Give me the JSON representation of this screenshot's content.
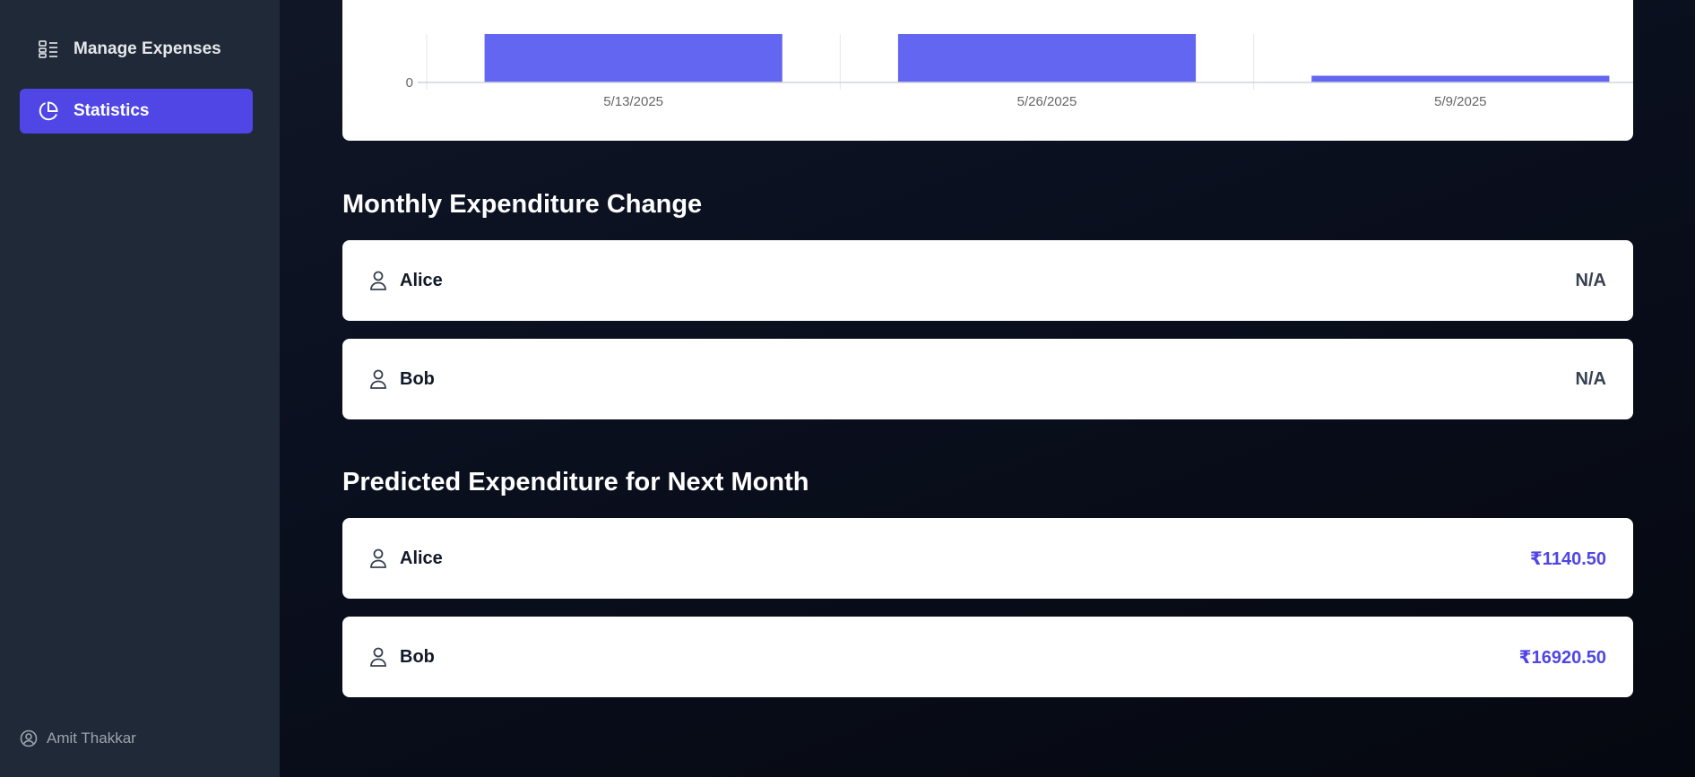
{
  "sidebar": {
    "items": [
      {
        "label": "Manage Expenses",
        "icon": "list-icon",
        "active": false
      },
      {
        "label": "Statistics",
        "icon": "pie-chart-icon",
        "active": true
      }
    ],
    "user": {
      "name": "Amit Thakkar",
      "icon": "user-circle-icon"
    }
  },
  "colors": {
    "accent": "#4f46e5",
    "bar": "#6366f1",
    "sidebar_bg": "#1f2937"
  },
  "chart_data": {
    "type": "bar",
    "categories": [
      "5/13/2025",
      "5/26/2025",
      "5/9/2025"
    ],
    "values": [
      null,
      null,
      30
    ],
    "y_ticks": [
      "0"
    ],
    "note_values": "first two bars extend beyond the visible top of the chart"
  },
  "monthly_change": {
    "title": "Monthly Expenditure Change",
    "rows": [
      {
        "name": "Alice",
        "value": "N/A"
      },
      {
        "name": "Bob",
        "value": "N/A"
      }
    ]
  },
  "prediction": {
    "title": "Predicted Expenditure for Next Month",
    "rows": [
      {
        "name": "Alice",
        "value": "₹1140.50"
      },
      {
        "name": "Bob",
        "value": "₹16920.50"
      }
    ]
  }
}
